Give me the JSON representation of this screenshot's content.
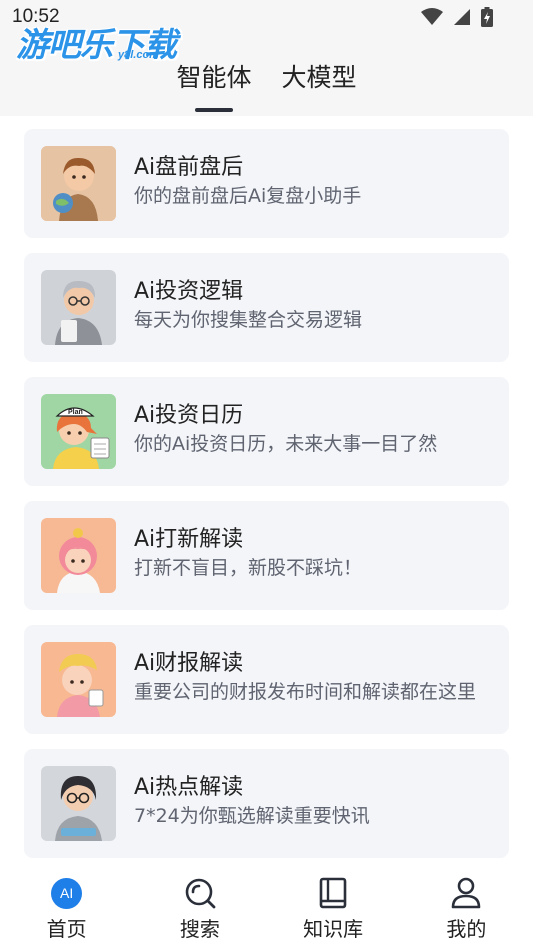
{
  "status_bar": {
    "time": "10:52"
  },
  "watermark": {
    "main": "游吧乐下载",
    "sub": "y8l.com"
  },
  "tabs": [
    {
      "label": "智能体",
      "active": true
    },
    {
      "label": "大模型",
      "active": false
    }
  ],
  "cards": [
    {
      "title": "Ai盘前盘后",
      "desc": "你的盘前盘后Ai复盘小助手",
      "avatar_icon": "globe-kid-avatar"
    },
    {
      "title": "Ai投资逻辑",
      "desc": "每天为你搜集整合交易逻辑",
      "avatar_icon": "grey-hair-man-avatar"
    },
    {
      "title": "Ai投资日历",
      "desc": "你的Ai投资日历，未来大事一目了然",
      "avatar_icon": "plan-cap-girl-avatar",
      "avatar_cap_text": "Plan"
    },
    {
      "title": "Ai打新解读",
      "desc": "打新不盲目，新股不踩坑！",
      "avatar_icon": "pink-hair-girl-avatar"
    },
    {
      "title": "Ai财报解读",
      "desc": "重要公司的财报发布时间和解读都在这里",
      "avatar_icon": "yellow-hat-girl-avatar"
    },
    {
      "title": "Ai热点解读",
      "desc": "7*24为你甄选解读重要快讯",
      "avatar_icon": "glasses-girl-avatar"
    }
  ],
  "bottom_nav": [
    {
      "label": "首页",
      "icon": "ai-home-icon",
      "badge": "AI"
    },
    {
      "label": "搜索",
      "icon": "search-icon"
    },
    {
      "label": "知识库",
      "icon": "book-icon"
    },
    {
      "label": "我的",
      "icon": "user-icon"
    }
  ],
  "colors": {
    "accent": "#1f7fe8",
    "card_bg": "#f4f5f9",
    "header_bg": "#f6f6f6",
    "watermark": "#2b93e8"
  }
}
